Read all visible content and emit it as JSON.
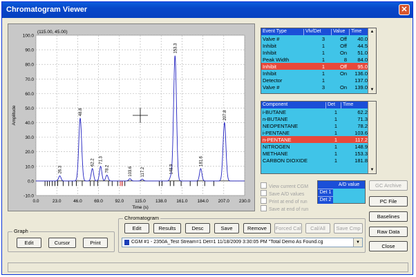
{
  "window": {
    "title": "Chromatogram Viewer",
    "close_glyph": "✕"
  },
  "plot": {
    "coord_readout": "(115.00, 45.00)",
    "ylabel": "Amplitude",
    "xlabel": "Time (s)",
    "yticks": [
      "100.0",
      "90.0",
      "80.0",
      "70.0",
      "60.0",
      "50.0",
      "40.0",
      "30.0",
      "20.0",
      "10.0",
      "0.0",
      "-10.0"
    ],
    "xticks": [
      "0.0",
      "23.0",
      "46.0",
      "69.0",
      "92.0",
      "115.0",
      "138.0",
      "161.0",
      "184.0",
      "207.0",
      "230.0"
    ]
  },
  "chart_data": {
    "type": "line",
    "xlabel": "Time (s)",
    "ylabel": "Amplitude",
    "xlim": [
      0,
      230
    ],
    "ylim": [
      -10,
      100
    ],
    "series_color": "#2020c0",
    "peaks": [
      {
        "t": 26.3,
        "h": 3.5,
        "label": "26.3"
      },
      {
        "t": 48.8,
        "h": 43.0,
        "label": "48.8"
      },
      {
        "t": 62.2,
        "h": 8.5,
        "label": "62.2"
      },
      {
        "t": 71.3,
        "h": 10.0,
        "label": "71.3"
      },
      {
        "t": 78.2,
        "h": 4.0,
        "label": "78.2"
      },
      {
        "t": 103.6,
        "h": 1.5,
        "label": "103.6"
      },
      {
        "t": 117.2,
        "h": 1.2,
        "label": "117.2"
      },
      {
        "t": 148.9,
        "h": 3.0,
        "label": "148.9"
      },
      {
        "t": 153.3,
        "h": 86.0,
        "label": "153.3"
      },
      {
        "t": 181.6,
        "h": 8.5,
        "label": "181.6"
      },
      {
        "t": 207.8,
        "h": 40.0,
        "label": "207.8"
      }
    ],
    "crosshair": {
      "x": 115.0,
      "y": 45.0
    },
    "event_markers": [
      10.0,
      12.5,
      15.0,
      18.0,
      21.0,
      24.0,
      30.0,
      36.0,
      40.0,
      44.5,
      51.0,
      60.0,
      64.0,
      68.0,
      80.0,
      84.0,
      90.0,
      95.0,
      98.0,
      136.0,
      139.0,
      148.0,
      152.0,
      160.0,
      170.0,
      178.0,
      186.0,
      196.0
    ],
    "highlight_markers": [
      93.0,
      95.0
    ]
  },
  "event_table": {
    "headers": [
      "Event Type",
      "Vlv/Det",
      "Value",
      "Time"
    ],
    "rows": [
      [
        "Valve #",
        "3",
        "Off",
        "40.0"
      ],
      [
        "Inhibit",
        "1",
        "Off",
        "44.5"
      ],
      [
        "Inhibit",
        "1",
        "On",
        "51.0"
      ],
      [
        "Peak Width",
        "1",
        "8",
        "84.0"
      ],
      [
        "Inhibit",
        "1",
        "Off",
        "95.0"
      ],
      [
        "Inhibit",
        "1",
        "On",
        "136.0"
      ],
      [
        "Detector",
        "1",
        "",
        "137.0"
      ],
      [
        "Valve #",
        "3",
        "On",
        "139.0"
      ]
    ],
    "selected_row": 4
  },
  "component_table": {
    "headers": [
      "Component",
      "Det",
      "Time"
    ],
    "rows": [
      [
        "i-BUTANE",
        "1",
        "62.2"
      ],
      [
        "n-BUTANE",
        "1",
        "71.3"
      ],
      [
        "NEOPENTANE",
        "1",
        "78.2"
      ],
      [
        "i-PENTANE",
        "1",
        "103.6"
      ],
      [
        "n-PENTANE",
        "1",
        "117.2"
      ],
      [
        "NITROGEN",
        "1",
        "148.9"
      ],
      [
        "METHANE",
        "1",
        "153.3"
      ],
      [
        "CARBON DIOXIDE",
        "1",
        "181.8"
      ]
    ],
    "selected_row": 4
  },
  "checkboxes": [
    "View current CGM",
    "Save A/D values",
    "Print at end of run",
    "Save at end of run"
  ],
  "ad_box": {
    "header": "A/D value",
    "det1": "Det 1",
    "det2": "Det 2"
  },
  "right_buttons": [
    "GC Archive",
    "PC File",
    "Baselines",
    "Raw Data",
    "Close"
  ],
  "graph_group": {
    "label": "Graph",
    "buttons": [
      "Edit",
      "Cursor",
      "Print"
    ]
  },
  "chromatogram_group": {
    "label": "Chromatogram",
    "buttons": [
      "Edit",
      "Results",
      "Desc",
      "Save",
      "Remove",
      "Forced Cal",
      "Cal/All",
      "Save Cmp"
    ],
    "disabled": [
      false,
      false,
      false,
      false,
      false,
      true,
      true,
      true
    ],
    "combo_value": "CGM #1 - 2350A_Test  Stream=1 Det=1 11/18/2009 3:30:05 PM \"Total Demo As Found.cg"
  }
}
